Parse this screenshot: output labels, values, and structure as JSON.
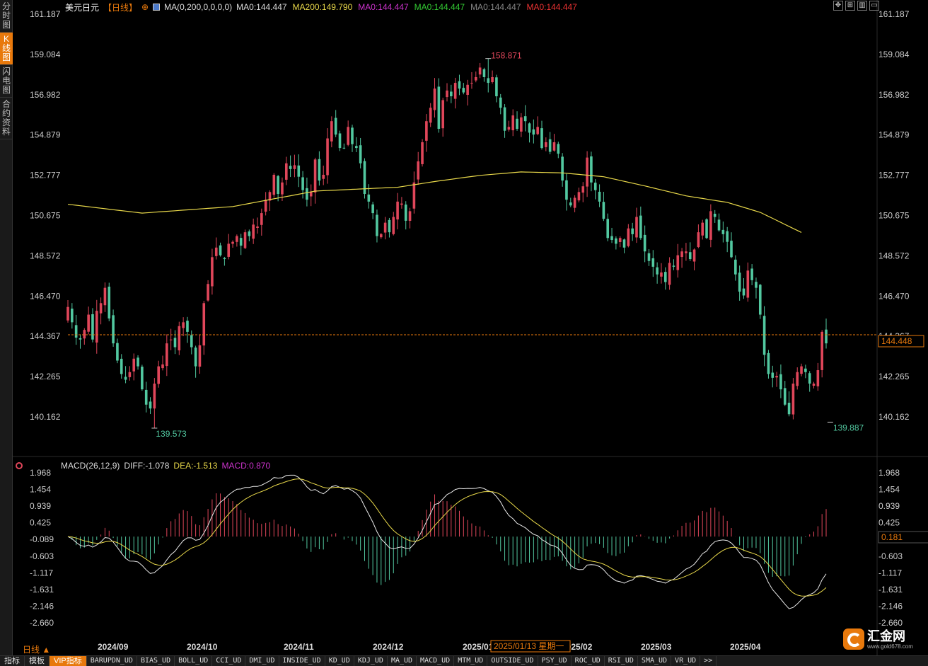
{
  "sidebar": {
    "tabs": [
      {
        "label": "分时图",
        "active": false
      },
      {
        "label": "K线图",
        "active": true
      },
      {
        "label": "闪电图",
        "active": false
      },
      {
        "label": "合约资料",
        "active": false
      }
    ]
  },
  "header": {
    "symbol": "美元日元",
    "period": "【日线】",
    "ma_config": "MA(0,200,0,0,0,0)",
    "ma_values": [
      {
        "text": "MA0:144.447",
        "color": "#dddddd"
      },
      {
        "text": "MA200:149.790",
        "color": "#e8d84a"
      },
      {
        "text": "MA0:144.447",
        "color": "#cc33cc"
      },
      {
        "text": "MA0:144.447",
        "color": "#33cc33"
      },
      {
        "text": "MA0:144.447",
        "color": "#888888"
      },
      {
        "text": "MA0:144.447",
        "color": "#ee3333"
      }
    ]
  },
  "macd_header": {
    "title": "MACD(26,12,9)",
    "diff": "DIFF:-1.078",
    "dea": "DEA:-1.513",
    "macd": "MACD:0.870"
  },
  "colors": {
    "up": "#e0465a",
    "down": "#52c8a0",
    "ma200": "#e8d84a",
    "current": "#e8790c",
    "grid": "#333333",
    "axis_text": "#cccccc"
  },
  "chart_data": {
    "type": "candlestick",
    "price_axis_ticks": [
      "161.187",
      "159.084",
      "156.982",
      "154.879",
      "152.777",
      "150.675",
      "148.572",
      "146.470",
      "144.367",
      "142.265",
      "140.162"
    ],
    "price_range": [
      138.47,
      161.39
    ],
    "macd_axis_ticks": [
      "1.968",
      "1.454",
      "0.939",
      "0.425",
      "-0.089",
      "-0.603",
      "-1.117",
      "-1.631",
      "-2.146",
      "-2.660"
    ],
    "macd_range": [
      -2.95,
      2.1
    ],
    "x_labels": [
      "2024/09",
      "2024/10",
      "2024/11",
      "2024/12",
      "2025/01",
      "2025/02",
      "2025/03",
      "2025/04"
    ],
    "crosshair_date": "2025/01/13 星期一",
    "current_price": "144.448",
    "current_macd": "0.181",
    "high_label": "158.871",
    "low_label_1": "139.573",
    "low_label_2": "139.887",
    "ma200_anchors": [
      [
        0,
        151.26
      ],
      [
        18,
        150.8
      ],
      [
        40,
        151.14
      ],
      [
        60,
        151.95
      ],
      [
        80,
        152.15
      ],
      [
        90,
        152.48
      ],
      [
        100,
        152.77
      ],
      [
        110,
        152.95
      ],
      [
        120,
        152.9
      ],
      [
        130,
        152.7
      ],
      [
        140,
        152.22
      ],
      [
        150,
        151.7
      ],
      [
        160,
        151.36
      ],
      [
        168,
        150.84
      ],
      [
        178,
        149.79
      ]
    ],
    "closes": [
      145.9,
      145.1,
      144.3,
      144.2,
      144.7,
      145.5,
      144.2,
      145.7,
      146.1,
      146.9,
      145.3,
      144.0,
      143.1,
      142.4,
      142.1,
      142.5,
      143.2,
      142.8,
      141.6,
      140.8,
      140.6,
      141.9,
      142.8,
      142.9,
      144.0,
      144.2,
      143.8,
      144.9,
      145.1,
      144.6,
      143.8,
      142.8,
      143.9,
      146.1,
      147.1,
      148.5,
      149.0,
      148.6,
      148.4,
      149.2,
      149.3,
      149.6,
      149.1,
      149.8,
      149.6,
      150.2,
      150.1,
      150.8,
      151.5,
      151.9,
      152.8,
      151.8,
      152.4,
      153.4,
      153.1,
      153.3,
      152.7,
      152.0,
      151.5,
      151.9,
      153.6,
      152.5,
      152.8,
      154.7,
      155.6,
      154.9,
      154.2,
      154.2,
      155.3,
      154.4,
      154.2,
      153.4,
      151.8,
      151.4,
      150.8,
      149.6,
      149.7,
      150.3,
      149.8,
      150.6,
      151.4,
      151.3,
      150.4,
      150.9,
      152.4,
      153.5,
      154.5,
      155.6,
      156.3,
      157.3,
      155.2,
      156.7,
      157.2,
      156.9,
      157.6,
      157.3,
      157.1,
      157.5,
      157.6,
      157.9,
      158.4,
      157.9,
      157.6,
      157.9,
      156.9,
      156.3,
      155.1,
      155.3,
      155.9,
      155.2,
      155.8,
      155.6,
      155.0,
      154.9,
      155.3,
      154.2,
      154.5,
      154.0,
      154.5,
      153.9,
      152.5,
      151.5,
      151.2,
      151.6,
      151.9,
      152.2,
      153.7,
      152.4,
      152.0,
      151.4,
      150.5,
      149.5,
      149.4,
      149.2,
      149.5,
      149.0,
      150.0,
      149.7,
      150.6,
      149.5,
      148.8,
      148.3,
      148.0,
      147.6,
      147.7,
      147.2,
      148.2,
      148.0,
      148.6,
      148.8,
      148.8,
      148.4,
      148.9,
      149.8,
      150.3,
      149.5,
      150.9,
      150.6,
      149.9,
      149.7,
      149.3,
      148.5,
      147.6,
      146.7,
      146.5,
      147.8,
      147.3,
      146.9,
      145.5,
      143.4,
      142.4,
      142.2,
      142.3,
      141.6,
      140.8,
      140.3,
      141.9,
      142.5,
      142.8,
      142.5,
      141.9,
      141.9,
      142.6,
      144.6,
      144.0
    ]
  },
  "logo": {
    "text": "汇金网",
    "sub": "www.gold678.com"
  },
  "period_label": "日线",
  "bottom_tabs": [
    {
      "label": "指标",
      "style": "normal"
    },
    {
      "label": "模板",
      "style": "normal"
    },
    {
      "label": "VIP指标",
      "style": "vip"
    },
    {
      "label": "BARUPDN_UD",
      "style": "small"
    },
    {
      "label": "BIAS_UD",
      "style": "small"
    },
    {
      "label": "BOLL_UD",
      "style": "small"
    },
    {
      "label": "CCI_UD",
      "style": "small"
    },
    {
      "label": "DMI_UD",
      "style": "small"
    },
    {
      "label": "INSIDE_UD",
      "style": "small"
    },
    {
      "label": "KD_UD",
      "style": "small"
    },
    {
      "label": "KDJ_UD",
      "style": "small"
    },
    {
      "label": "MA_UD",
      "style": "small"
    },
    {
      "label": "MACD_UD",
      "style": "small"
    },
    {
      "label": "MTM_UD",
      "style": "small"
    },
    {
      "label": "OUTSIDE_UD",
      "style": "small"
    },
    {
      "label": "PSY_UD",
      "style": "small"
    },
    {
      "label": "ROC_UD",
      "style": "small"
    },
    {
      "label": "RSI_UD",
      "style": "small"
    },
    {
      "label": "SMA_UD",
      "style": "small"
    },
    {
      "label": "VR_UD",
      "style": "small"
    },
    {
      "label": ">>",
      "style": "small"
    }
  ]
}
